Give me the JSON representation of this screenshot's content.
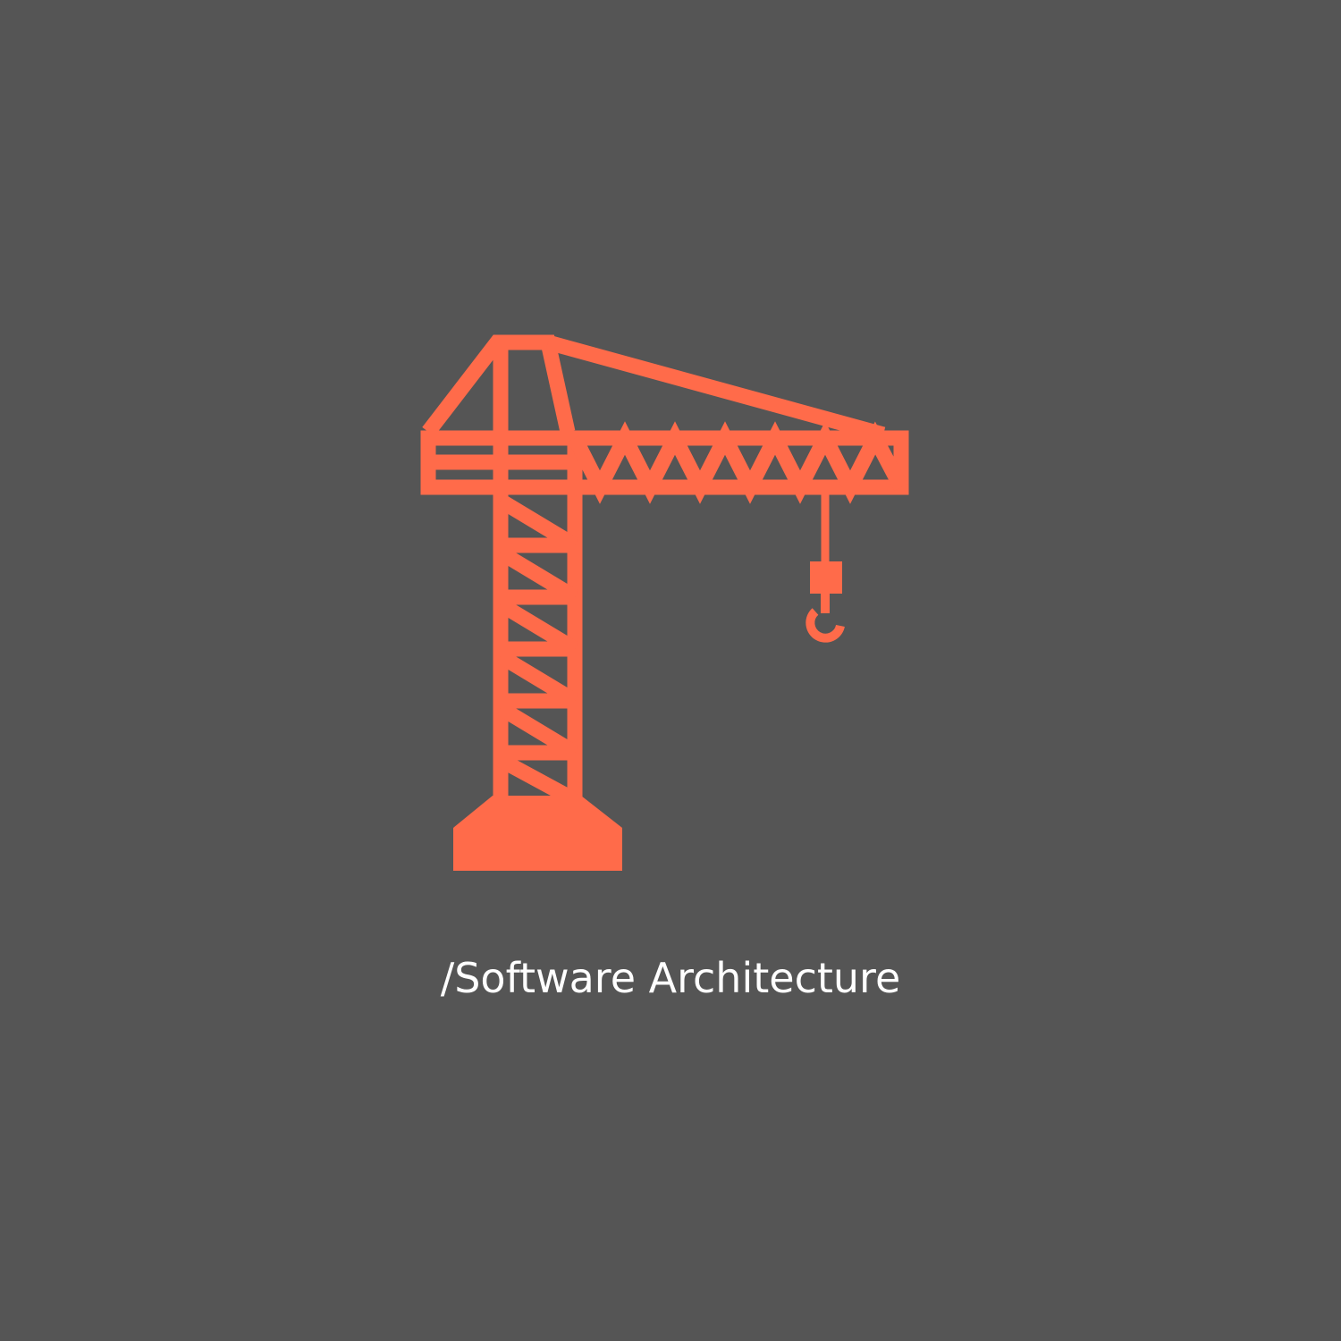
{
  "icon": {
    "name": "construction-crane-icon",
    "color": "#ff6b4a"
  },
  "background_color": "#555555",
  "caption": {
    "text": "/Software Architecture",
    "color": "#ffffff"
  }
}
